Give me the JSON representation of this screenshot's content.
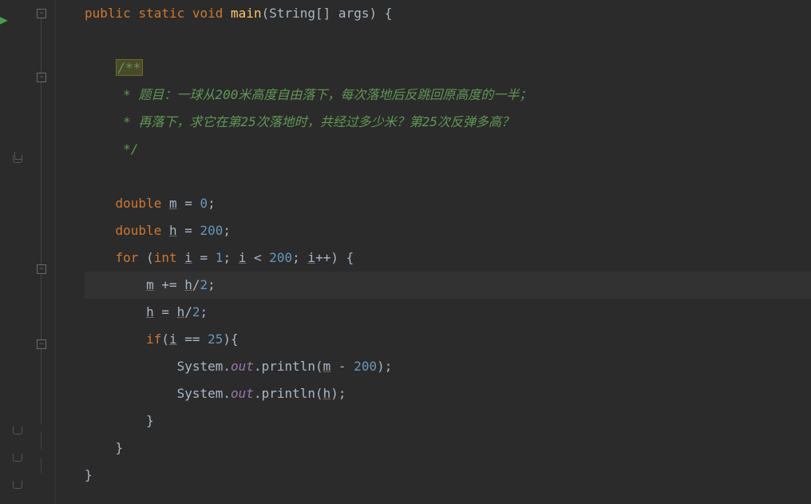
{
  "code": {
    "line1_public": "public",
    "line1_static": "static",
    "line1_void": "void",
    "line1_main": "main",
    "line1_string": "String",
    "line1_args": "args",
    "line3_comment_start": "/**",
    "line4_comment": " * 题目：一球从200米高度自由落下，每次落地后反跳回原高度的一半；",
    "line5_comment": " * 再落下，求它在第25次落地时，共经过多少米？第25次反弹多高？",
    "line6_comment": " */",
    "line8_double": "double",
    "line8_m": "m",
    "line8_val": "0",
    "line9_double": "double",
    "line9_h": "h",
    "line9_val": "200",
    "line10_for": "for",
    "line10_int": "int",
    "line10_i": "i",
    "line10_init": "1",
    "line10_cond_i": "i",
    "line10_cond_val": "200",
    "line10_inc_i": "i",
    "line11_m": "m",
    "line11_h": "h",
    "line11_val": "2",
    "line12_h1": "h",
    "line12_h2": "h",
    "line12_val": "2",
    "line13_if": "if",
    "line13_i": "i",
    "line13_val": "25",
    "line14_system": "System",
    "line14_out": "out",
    "line14_println": "println",
    "line14_m": "m",
    "line14_val": "200",
    "line15_system": "System",
    "line15_out": "out",
    "line15_println": "println",
    "line15_h": "h"
  }
}
